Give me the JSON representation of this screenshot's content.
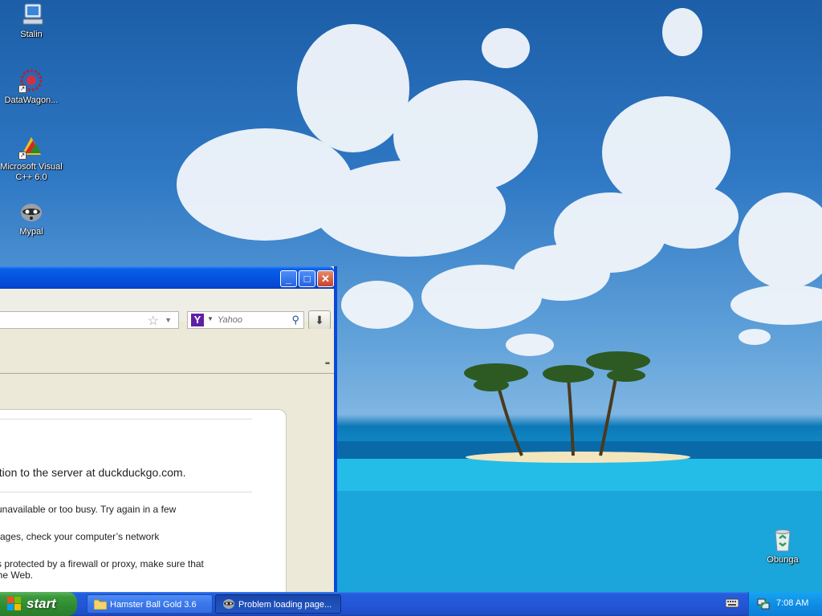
{
  "desktop": {
    "icons": [
      {
        "label": "Stalin",
        "icon": "computer-icon"
      },
      {
        "label": "DataWagon...",
        "icon": "datawagon-icon"
      },
      {
        "label": "Microsoft Visual C++ 6.0",
        "icon": "visual-cpp-icon"
      },
      {
        "label": "Mypal",
        "icon": "mypal-icon"
      },
      {
        "label": "Obunga",
        "icon": "recycle-bin-icon"
      }
    ]
  },
  "browser": {
    "title_buttons": {
      "minimize": "_",
      "maximize": "□",
      "close": "✕"
    },
    "search": {
      "engine": "Yahoo",
      "placeholder": "Yahoo"
    },
    "error": {
      "main": "ection to the server at duckduckgo.com.",
      "items": [
        "ly unavailable or too busy. Try again in a few",
        "y pages, check your computer’s network",
        "k is protected by a firewall or proxy, make sure that",
        "s the Web."
      ]
    }
  },
  "taskbar": {
    "start_label": "start",
    "tasks": [
      {
        "label": "Hamster Ball Gold 3.6",
        "icon": "folder-icon",
        "active": false
      },
      {
        "label": "Problem loading page...",
        "icon": "mypal-icon",
        "active": true
      }
    ],
    "clock": "7:08 AM"
  },
  "colors": {
    "taskbar": "#245edb",
    "start_green": "#3c9a3c",
    "titlebar": "#0454e0",
    "tray": "#0f8ee6"
  }
}
